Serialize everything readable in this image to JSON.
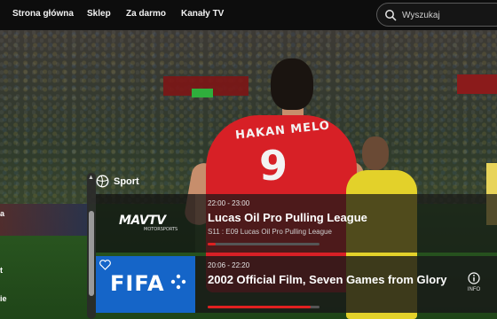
{
  "nav": {
    "items": [
      {
        "label": "Strona główna"
      },
      {
        "label": "Sklep"
      },
      {
        "label": "Za darmo"
      },
      {
        "label": "Kanały TV"
      }
    ],
    "search_placeholder": "Wyszukaj"
  },
  "hero": {
    "player_name": "HAKAN MELO",
    "player_number": "9"
  },
  "category": {
    "title": "Sport",
    "icon": "sports-ball-icon"
  },
  "left_edge": [
    "a",
    "t",
    "ie"
  ],
  "programs": [
    {
      "channel": "MAVTV",
      "channel_sub": "MOTORSPORTS",
      "time": "22:00 - 23:00",
      "title": "Lucas Oil Pro Pulling League",
      "subtitle": "S11 : E09 Lucas Oil Pro Pulling League",
      "progress": 0.07
    },
    {
      "channel": "FIFA",
      "time": "20:06 - 22:20",
      "title": "2002 Official Film, Seven Games from Glory",
      "info_label": "INFO",
      "progress": 0.92
    }
  ],
  "colors": {
    "accent": "#e02020",
    "fifa_blue": "#1565c8"
  }
}
